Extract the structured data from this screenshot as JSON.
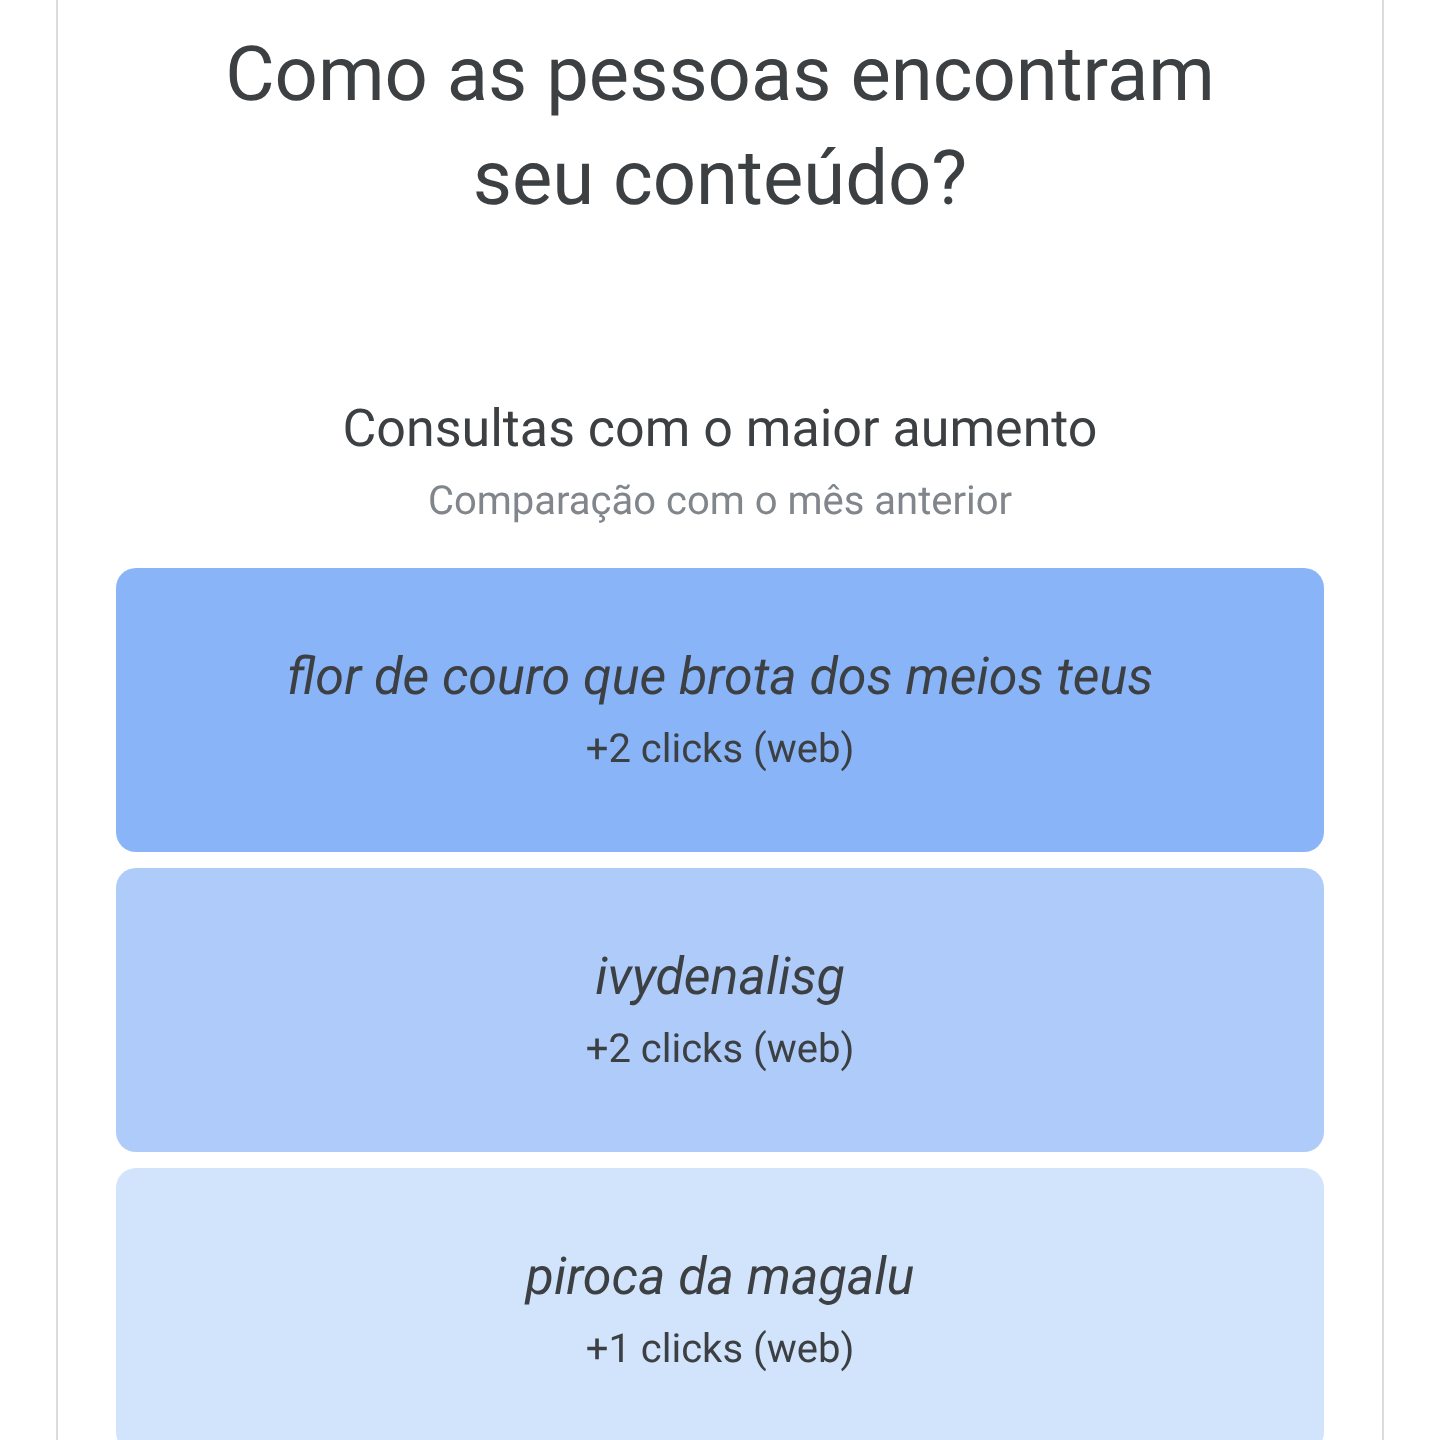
{
  "title": "Como as pessoas encontram seu conteúdo?",
  "section": {
    "heading": "Consultas com o maior aumento",
    "subheading": "Comparação com o mês anterior"
  },
  "queries": [
    {
      "query": "flor de couro que brota dos meios teus",
      "clicks": "+2 clicks (web)",
      "color": "#8ab4f8"
    },
    {
      "query": "ivydenalisg",
      "clicks": "+2 clicks (web)",
      "color": "#aecbfa"
    },
    {
      "query": "piroca da magalu",
      "clicks": "+1 clicks (web)",
      "color": "#d2e3fc"
    }
  ]
}
